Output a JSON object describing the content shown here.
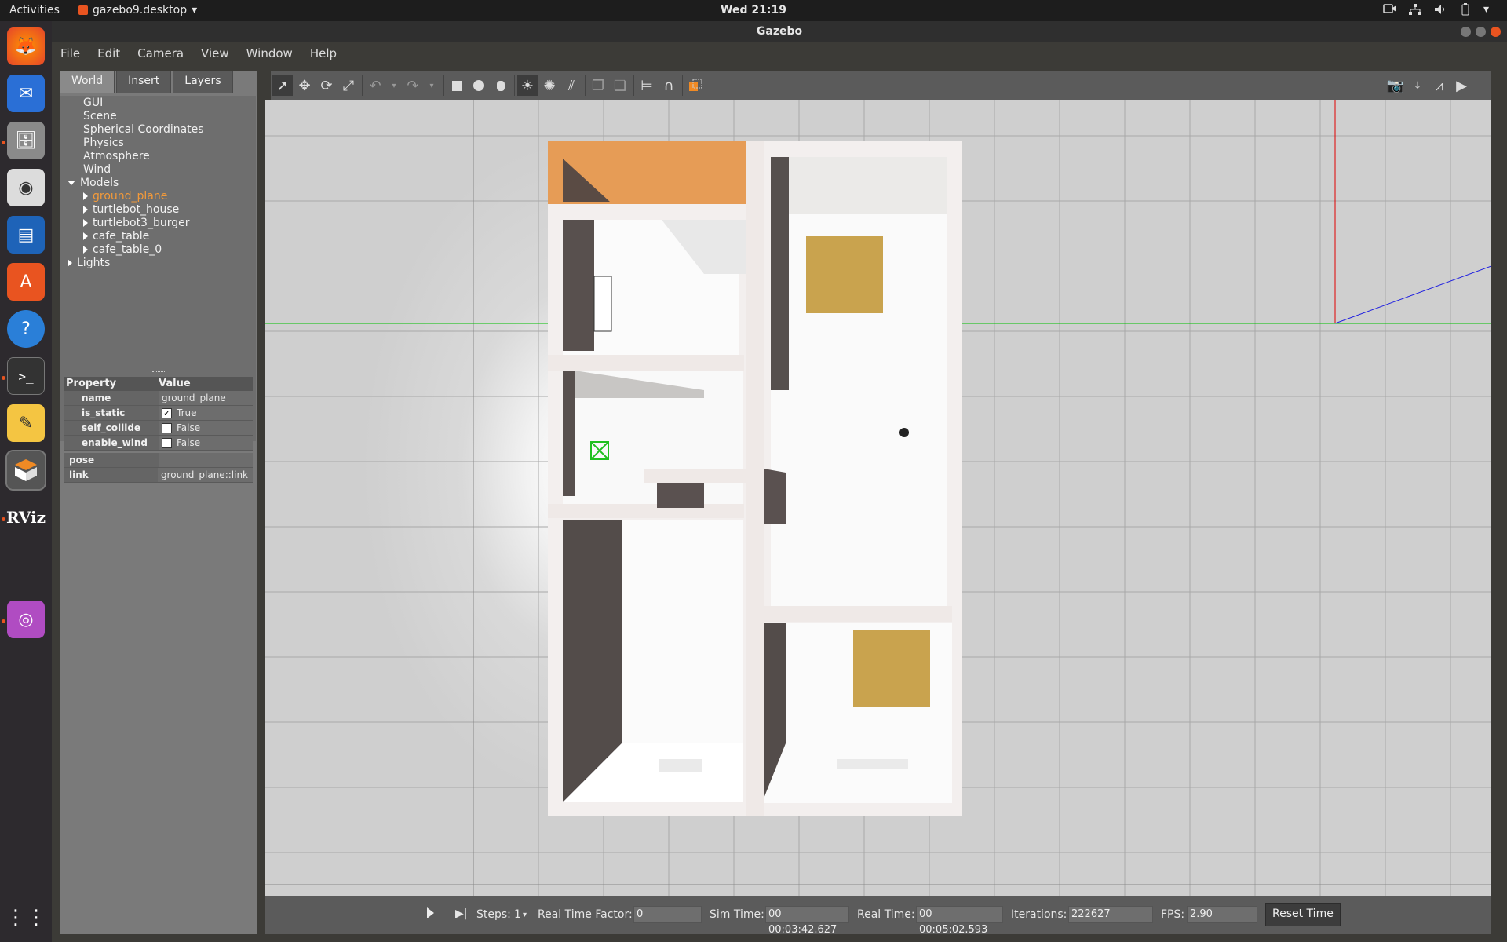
{
  "topbar": {
    "activities": "Activities",
    "app_name": "gazebo9.desktop",
    "clock": "Wed 21:19"
  },
  "window": {
    "title": "Gazebo"
  },
  "menu": {
    "file": "File",
    "edit": "Edit",
    "camera": "Camera",
    "view": "View",
    "window": "Window",
    "help": "Help"
  },
  "tabs": {
    "world": "World",
    "insert": "Insert",
    "layers": "Layers"
  },
  "tree": {
    "gui": "GUI",
    "scene": "Scene",
    "spherical": "Spherical Coordinates",
    "physics": "Physics",
    "atmosphere": "Atmosphere",
    "wind": "Wind",
    "models": "Models",
    "models_items": [
      "ground_plane",
      "turtlebot_house",
      "turtlebot3_burger",
      "cafe_table",
      "cafe_table_0"
    ],
    "lights": "Lights"
  },
  "properties": {
    "header_property": "Property",
    "header_value": "Value",
    "name_key": "name",
    "name_val": "ground_plane",
    "is_static_key": "is_static",
    "is_static_val": "True",
    "is_static_mark": "✓",
    "self_collide_key": "self_collide",
    "self_collide_val": "False",
    "enable_wind_key": "enable_wind",
    "enable_wind_val": "False",
    "pose_key": "pose",
    "link_key": "link",
    "link_val": "ground_plane::link"
  },
  "bottom": {
    "steps_label": "Steps:",
    "steps_val": "1",
    "rtf_label": "Real Time Factor:",
    "rtf_val": "0",
    "sim_label": "Sim Time:",
    "sim_val": "00 00:03:42.627",
    "real_label": "Real Time:",
    "real_val": "00 00:05:02.593",
    "iter_label": "Iterations:",
    "iter_val": "222627",
    "fps_label": "FPS:",
    "fps_val": "2.90",
    "reset": "Reset Time"
  },
  "colors": {
    "accent": "#e95420",
    "selected_tree": "#f39a3a",
    "grid_x": "#00c000",
    "grid_y": "#e00000",
    "grid_z": "#2020e0"
  }
}
